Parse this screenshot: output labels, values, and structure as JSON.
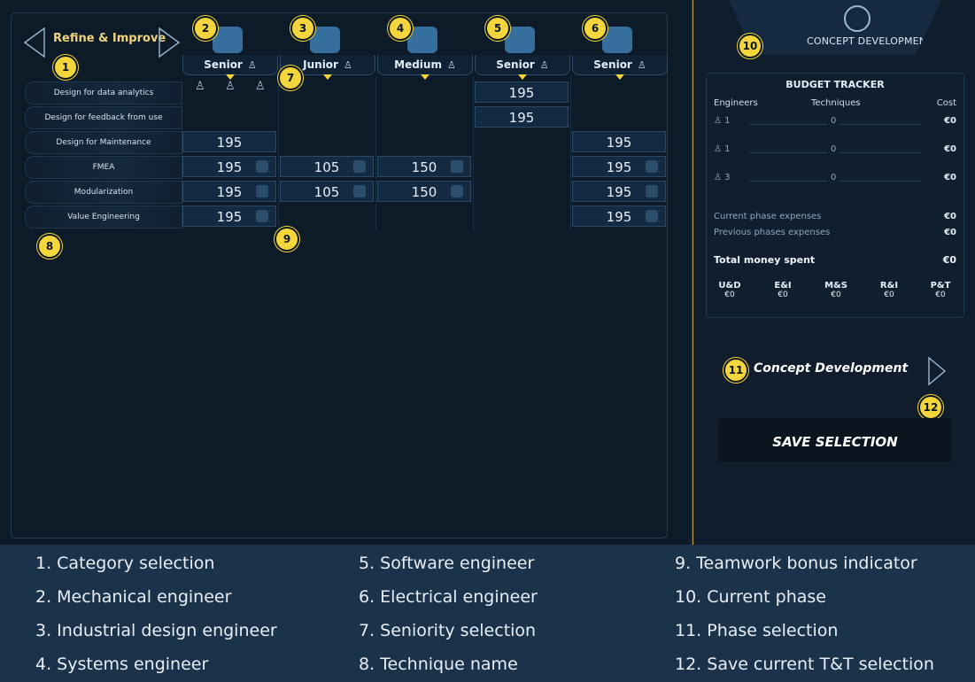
{
  "category": {
    "label": "Refine & Improve"
  },
  "columns": [
    {
      "seniority": "Senior",
      "icon": "wrench-icon"
    },
    {
      "seniority": "Junior",
      "icon": "pencil-icon"
    },
    {
      "seniority": "Medium",
      "icon": "server-icon"
    },
    {
      "seniority": "Senior",
      "icon": "code-icon"
    },
    {
      "seniority": "Senior",
      "icon": "lightning-icon"
    }
  ],
  "rows": [
    {
      "name": "Design for data analytics",
      "cells": [
        "",
        "",
        "",
        "195",
        ""
      ]
    },
    {
      "name": "Design for feedback from use",
      "cells": [
        "",
        "",
        "",
        "195",
        ""
      ]
    },
    {
      "name": "Design for Maintenance",
      "cells": [
        "195",
        "",
        "",
        "",
        "195"
      ]
    },
    {
      "name": "FMEA",
      "cells": [
        "195",
        "105",
        "150",
        "",
        "195"
      ]
    },
    {
      "name": "Modularization",
      "cells": [
        "195",
        "105",
        "150",
        "",
        "195"
      ]
    },
    {
      "name": "Value Engineering",
      "cells": [
        "195",
        "",
        "",
        "",
        "195"
      ]
    }
  ],
  "phase": {
    "title": "CONCEPT DEVELOPMENT",
    "selector": "Concept Development"
  },
  "budget": {
    "title": "BUDGET TRACKER",
    "headers": {
      "engineers": "Engineers",
      "techniques": "Techniques",
      "cost": "Cost"
    },
    "rows": [
      {
        "engineers": "1",
        "techniques": "0",
        "cost": "€0"
      },
      {
        "engineers": "1",
        "techniques": "0",
        "cost": "€0"
      },
      {
        "engineers": "3",
        "techniques": "0",
        "cost": "€0"
      }
    ],
    "current_label": "Current phase expenses",
    "current_value": "€0",
    "previous_label": "Previous phases expenses",
    "previous_value": "€0",
    "total_label": "Total money spent",
    "total_value": "€0",
    "split": [
      {
        "label": "U&D",
        "value": "€0"
      },
      {
        "label": "E&I",
        "value": "€0"
      },
      {
        "label": "M&S",
        "value": "€0"
      },
      {
        "label": "R&I",
        "value": "€0"
      },
      {
        "label": "P&T",
        "value": "€0"
      }
    ]
  },
  "save_label": "SAVE SELECTION",
  "badges": [
    "1",
    "2",
    "3",
    "4",
    "5",
    "6",
    "7",
    "8",
    "9",
    "10",
    "11",
    "12"
  ],
  "legend": [
    "1.  Category selection",
    "2.  Mechanical engineer",
    "3.  Industrial design engineer",
    "4.  Systems engineer",
    "5.  Software engineer",
    "6.  Electrical engineer",
    "7.  Seniority selection",
    "8.  Technique name",
    "9.  Teamwork bonus indicator",
    "10.  Current phase",
    "11.  Phase selection",
    "12.  Save current T&T selection"
  ]
}
